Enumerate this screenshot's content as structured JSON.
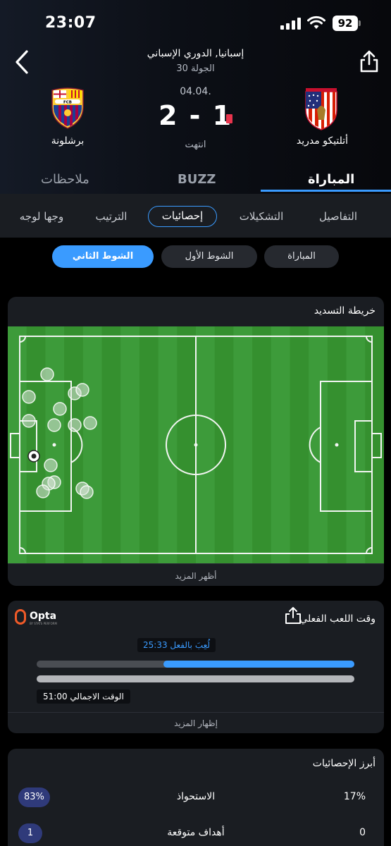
{
  "status_bar": {
    "time": "23:07",
    "battery": "92"
  },
  "match": {
    "league": "إسبانيا, الدوري الإسباني",
    "round": "الجولة 30",
    "date": "04.04.",
    "score": "2 - 1",
    "status": "انتهت",
    "home_team": "برشلونة",
    "away_team": "أتلتيكو مدريد"
  },
  "main_tabs": [
    "ملاحظات",
    "BUZZ",
    "المباراة"
  ],
  "sub_tabs": [
    "وجها لوجه",
    "الترتيب",
    "إحصائيات",
    "التشكيلات",
    "التفاصيل"
  ],
  "periods": [
    "الشوط الثاني",
    "الشوط الأول",
    "المباراة"
  ],
  "shot_map": {
    "title": "خريطة التسديد",
    "show_more": "أظهر المزيد",
    "shots": [
      {
        "type": "miss"
      },
      {
        "type": "miss"
      },
      {
        "type": "miss"
      },
      {
        "type": "miss"
      },
      {
        "type": "miss"
      },
      {
        "type": "miss"
      },
      {
        "type": "miss"
      },
      {
        "type": "miss"
      },
      {
        "type": "miss"
      },
      {
        "type": "miss"
      },
      {
        "type": "miss"
      },
      {
        "type": "miss"
      },
      {
        "type": "miss"
      },
      {
        "type": "miss"
      },
      {
        "type": "miss"
      },
      {
        "type": "goal"
      }
    ]
  },
  "effective_time": {
    "title": "وقت اللعب الفعلي",
    "provider": "Opta",
    "provider_sub": "BY STATS PERFORM",
    "played_label": "لُعِبَ بالفعل 25:33",
    "played_fraction": 0.6,
    "total_label": "الوقت الاجمالي 51:00",
    "show_more": "إظهار المزيد"
  },
  "top_stats": {
    "title": "أبرز الإحصائيات",
    "rows": [
      {
        "name": "الاستحواذ",
        "home": "83%",
        "away": "17%"
      },
      {
        "name": "أهداف متوقعة",
        "home": "1",
        "away": "0"
      }
    ]
  },
  "colors": {
    "accent": "#3a9bff",
    "pitch_light": "#3d9b3a",
    "pitch_dark": "#35902f",
    "red_card": "#e8344d",
    "stat_pill": "#2f3a7a"
  }
}
